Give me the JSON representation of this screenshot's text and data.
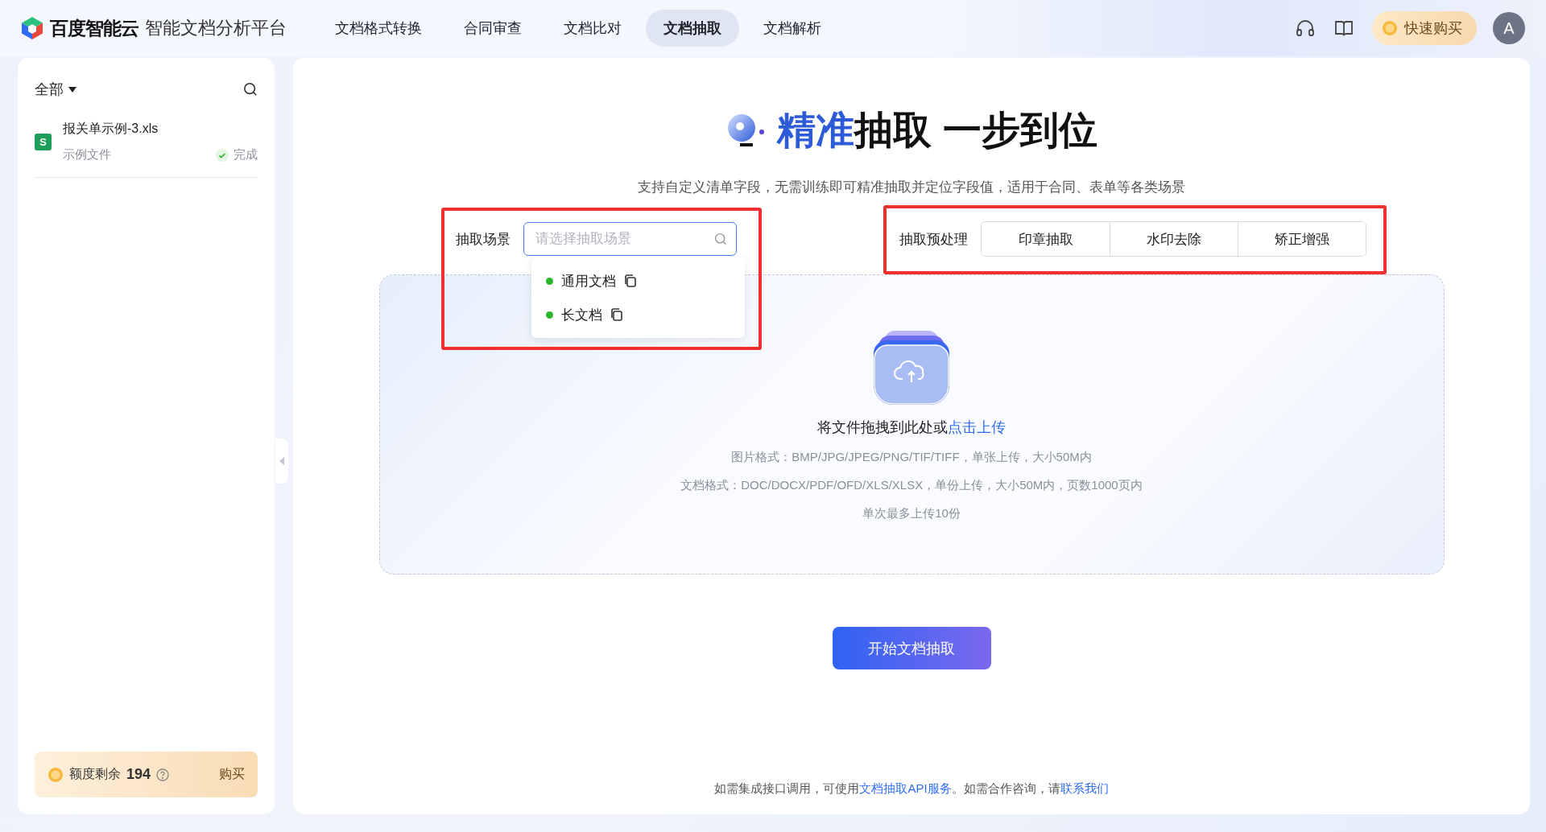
{
  "header": {
    "brand": "百度智能云",
    "product": "智能文档分析平台",
    "nav": [
      {
        "label": "文档格式转换",
        "selected": false
      },
      {
        "label": "合同审查",
        "selected": false
      },
      {
        "label": "文档比对",
        "selected": false
      },
      {
        "label": "文档抽取",
        "selected": true
      },
      {
        "label": "文档解析",
        "selected": false
      }
    ],
    "buy_button": "快速购买",
    "avatar": "A"
  },
  "sidebar": {
    "filter": "全部",
    "files": [
      {
        "icon": "S",
        "name": "报关单示例-3.xls",
        "tag": "示例文件",
        "status": "完成"
      }
    ],
    "quota": {
      "label": "额度剩余",
      "value": "194",
      "action": "购买"
    }
  },
  "main": {
    "title": [
      {
        "text": "精准",
        "highlight": true
      },
      {
        "text": "抽取 一步到位",
        "highlight": false
      }
    ],
    "subtitle": "支持自定义清单字段，无需训练即可精准抽取并定位字段值，适用于合同、表单等各类场景",
    "scene": {
      "label": "抽取场景",
      "placeholder": "请选择抽取场景",
      "options": [
        {
          "label": "通用文档"
        },
        {
          "label": "长文档"
        }
      ]
    },
    "preprocess": {
      "label": "抽取预处理",
      "options": [
        "印章抽取",
        "水印去除",
        "矫正增强"
      ]
    },
    "upload": {
      "prompt": "将文件拖拽到此处或",
      "link": "点击上传",
      "notes": [
        "图片格式：BMP/JPG/JPEG/PNG/TIF/TIFF，单张上传，大小50M内",
        "文档格式：DOC/DOCX/PDF/OFD/XLS/XLSX，单份上传，大小50M内，页数1000页内",
        "单次最多上传10份"
      ]
    },
    "start_button": "开始文档抽取",
    "footer": [
      {
        "kind": "text",
        "text": "如需集成接口调用，可使用"
      },
      {
        "kind": "link",
        "text": "文档抽取API服务"
      },
      {
        "kind": "text",
        "text": "。如需合作咨询，请"
      },
      {
        "kind": "link",
        "text": "联系我们"
      }
    ]
  }
}
